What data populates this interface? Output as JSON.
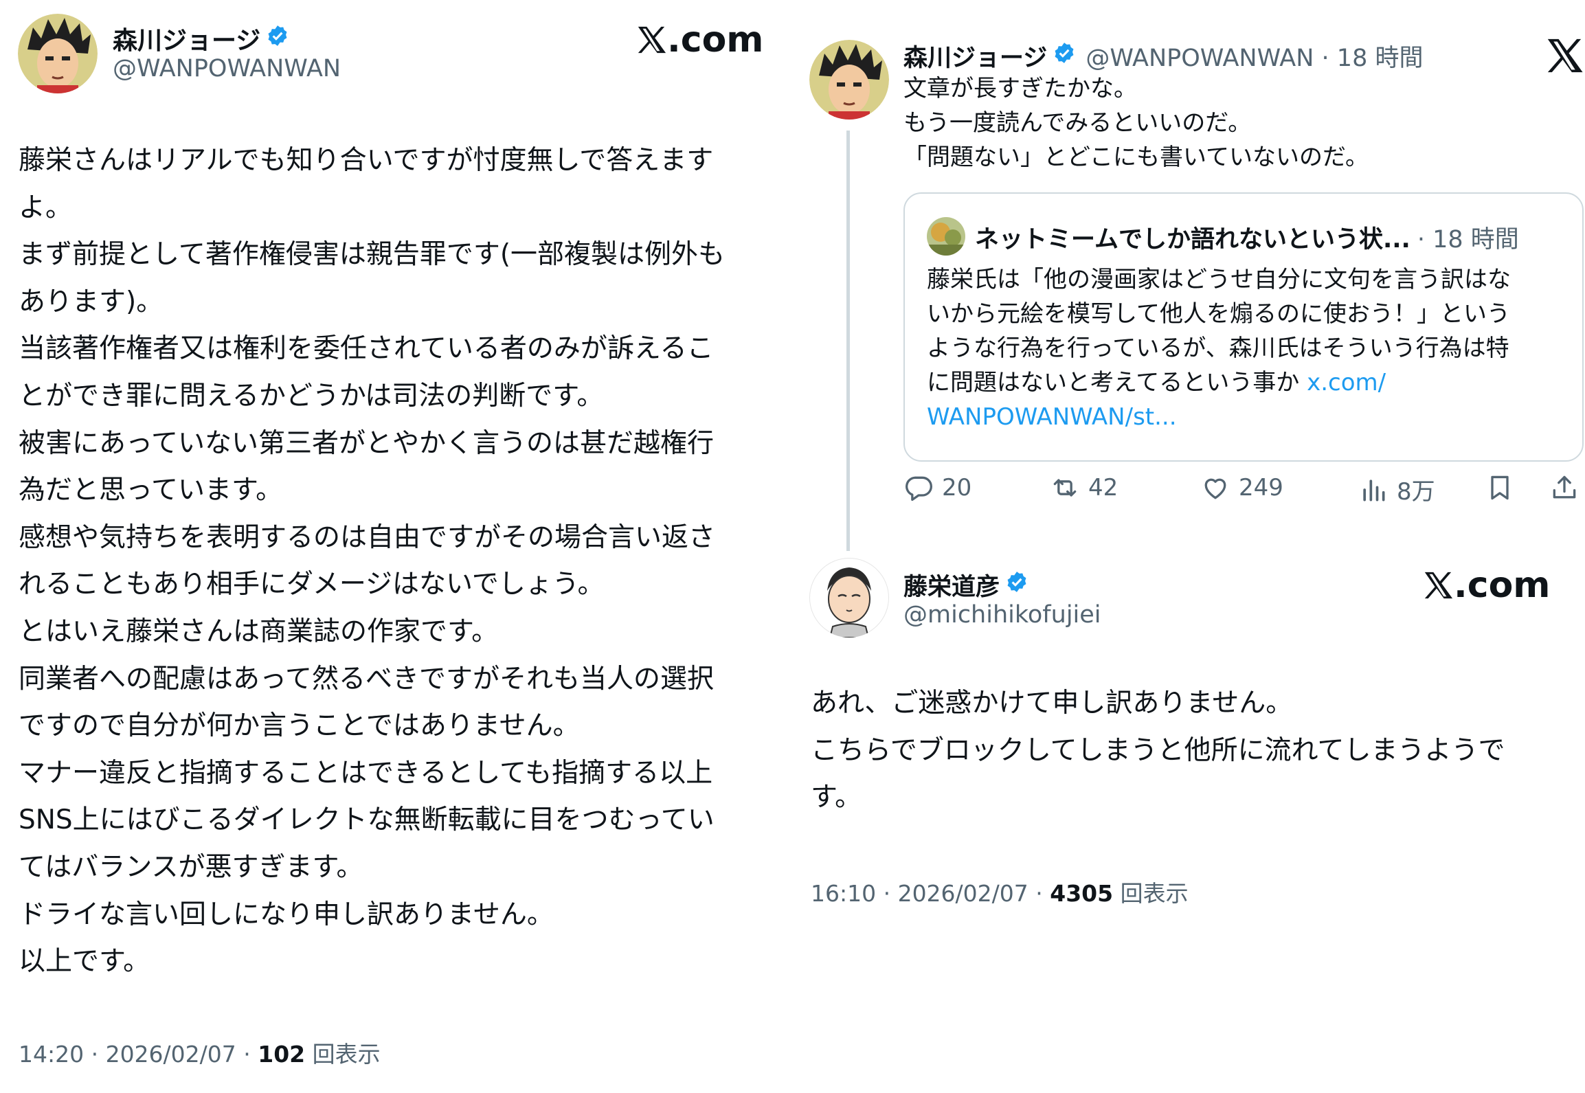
{
  "left_post": {
    "author": {
      "display_name": "森川ジョージ",
      "handle": "@WANPOWANWAN",
      "verified": true,
      "avatar_icon": "manga-character-avatar"
    },
    "logo_text": ".com",
    "logo_icon": "x-logo-icon",
    "body": "藤栄さんはリアルでも知り合いですが忖度無しで答えます\nよ。\nまず前提として著作権侵害は親告罪です(一部複製は例外も\nあります)。\n当該著作権者又は権利を委任されている者のみが訴えるこ\nとができ罪に問えるかどうかは司法の判断です。\n被害にあっていない第三者がとやかく言うのは甚だ越権行\n為だと思っています。\n感想や気持ちを表明するのは自由ですがその場合言い返さ\nれることもあり相手にダメージはないでしょう。\nとはいえ藤栄さんは商業誌の作家です。\n同業者への配慮はあって然るべきですがそれも当人の選択\nですので自分が何か言うことではありません。\nマナー違反と指摘することはできるとしても指摘する以上\nSNS上にはびこるダイレクトな無断転載に目をつむってい\nてはバランスが悪すぎます。\nドライな言い回しになり申し訳ありません。\n以上です。",
    "meta": {
      "time": "14:20 · 2026/02/07 · ",
      "views_count": "102",
      "views_label": " 回表示"
    }
  },
  "right_reply": {
    "author": {
      "display_name": "森川ジョージ",
      "handle_time": "@WANPOWANWAN · 18 時間",
      "verified": true
    },
    "close_icon": "x-close-icon",
    "body": "文章が長すぎたかな。\nもう一度読んでみるといいのだ。\n「問題ない」とどこにも書いていないのだ。",
    "quote": {
      "display_name": "ネットミームでしか語れないという状...",
      "time": "· 18 時間",
      "text": "藤栄氏は「他の漫画家はどうせ自分に文句を言う訳はな\nいから元絵を模写して他人を煽るのに使おう！」という\nような行為を行っているが、森川氏はそういう行為は特\nに問題はないと考えてるという事か ",
      "link_part1": "x.com/",
      "link_part2": "WANPOWANWAN/st..."
    },
    "actions": {
      "replies": "20",
      "reposts": "42",
      "likes": "249",
      "views": "8万"
    }
  },
  "right_post": {
    "author": {
      "display_name": "藤栄道彦",
      "handle": "@michihikofujiei",
      "verified": true,
      "avatar_icon": "cartoon-face-avatar"
    },
    "logo_text": ".com",
    "body": "あれ、ご迷惑かけて申し訳ありません。\nこちらでブロックしてしまうと他所に流れてしまうようで\nす。",
    "meta": {
      "time": "16:10 · 2026/02/07 · ",
      "views_count": "4305",
      "views_label": " 回表示"
    }
  },
  "colors": {
    "verified_blue": "#1d9bf0",
    "secondary_text": "#536471",
    "link": "#1d9bf0"
  }
}
